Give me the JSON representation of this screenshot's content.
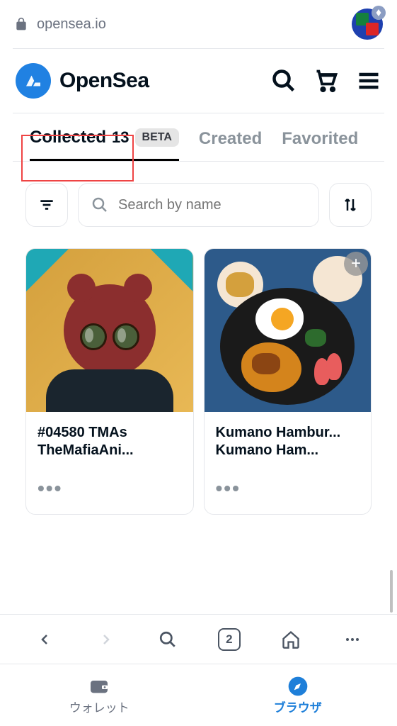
{
  "address_bar": {
    "url": "opensea.io"
  },
  "header": {
    "brand": "OpenSea"
  },
  "tabs": {
    "items": [
      {
        "label": "Collected",
        "count": "13",
        "beta": "BETA",
        "active": true
      },
      {
        "label": "Created",
        "active": false
      },
      {
        "label": "Favorited",
        "active": false
      }
    ]
  },
  "search": {
    "placeholder": "Search by name"
  },
  "cards": [
    {
      "title": "#04580 TMAs",
      "subtitle": "TheMafiaAni..."
    },
    {
      "title": "Kumano Hambur...",
      "subtitle": "Kumano Ham..."
    }
  ],
  "browser_nav": {
    "tab_count": "2"
  },
  "app_tabs": {
    "wallet": "ウォレット",
    "browser": "ブラウザ"
  }
}
